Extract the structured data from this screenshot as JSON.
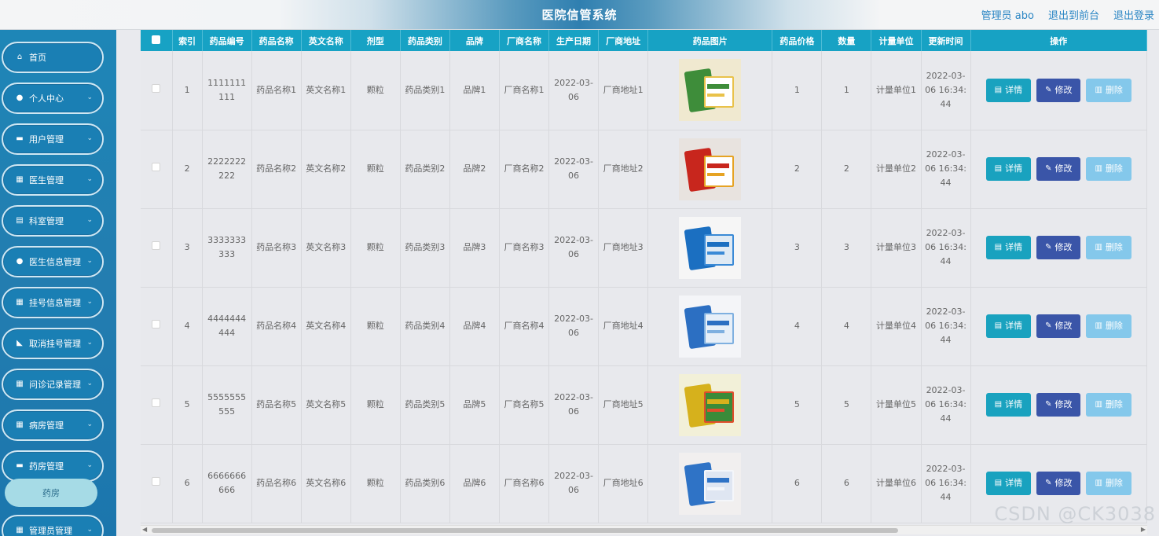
{
  "header": {
    "title": "医院信管系统",
    "links": [
      "管理员 abo",
      "退出到前台",
      "退出登录"
    ]
  },
  "sidebar": {
    "items": [
      {
        "label": "首页",
        "icon": "home-icon",
        "glyph": "⌂",
        "chevron": false
      },
      {
        "label": "个人中心",
        "icon": "user-icon",
        "glyph": "●",
        "chevron": true
      },
      {
        "label": "用户管理",
        "icon": "briefcase-icon",
        "glyph": "▬",
        "chevron": true
      },
      {
        "label": "医生管理",
        "icon": "grid-icon",
        "glyph": "▦",
        "chevron": true
      },
      {
        "label": "科室管理",
        "icon": "document-icon",
        "glyph": "▤",
        "chevron": true
      },
      {
        "label": "医生信息管理",
        "icon": "user-icon",
        "glyph": "●",
        "chevron": true
      },
      {
        "label": "挂号信息管理",
        "icon": "grid-icon",
        "glyph": "▦",
        "chevron": true
      },
      {
        "label": "取消挂号管理",
        "icon": "thumb-icon",
        "glyph": "◣",
        "chevron": true
      },
      {
        "label": "问诊记录管理",
        "icon": "grid-icon",
        "glyph": "▦",
        "chevron": true
      },
      {
        "label": "病房管理",
        "icon": "grid-icon",
        "glyph": "▦",
        "chevron": true
      },
      {
        "label": "药房管理",
        "icon": "car-icon",
        "glyph": "▬",
        "chevron": true
      },
      {
        "label": "管理员管理",
        "icon": "grid-icon",
        "glyph": "▦",
        "chevron": true
      }
    ],
    "submenu": {
      "label": "药房"
    }
  },
  "table": {
    "columns": [
      "",
      "索引",
      "药品编号",
      "药品名称",
      "英文名称",
      "剂型",
      "药品类别",
      "品牌",
      "厂商名称",
      "生产日期",
      "厂商地址",
      "药品图片",
      "药品价格",
      "数量",
      "计量单位",
      "更新时间",
      "操作"
    ],
    "rows": [
      {
        "index": "1",
        "code": "1111111111",
        "name": "药品名称1",
        "en": "英文名称1",
        "form": "颗粒",
        "category": "药品类别1",
        "brand": "品牌1",
        "maker": "厂商名称1",
        "date": "2022-03-06",
        "address": "厂商地址1",
        "image": "medicine-photo-1",
        "price": "1",
        "qty": "1",
        "unit": "计量单位1",
        "updated": "2022-03-06 16:34:44"
      },
      {
        "index": "2",
        "code": "2222222222",
        "name": "药品名称2",
        "en": "英文名称2",
        "form": "颗粒",
        "category": "药品类别2",
        "brand": "品牌2",
        "maker": "厂商名称2",
        "date": "2022-03-06",
        "address": "厂商地址2",
        "image": "medicine-photo-2",
        "price": "2",
        "qty": "2",
        "unit": "计量单位2",
        "updated": "2022-03-06 16:34:44"
      },
      {
        "index": "3",
        "code": "3333333333",
        "name": "药品名称3",
        "en": "英文名称3",
        "form": "颗粒",
        "category": "药品类别3",
        "brand": "品牌3",
        "maker": "厂商名称3",
        "date": "2022-03-06",
        "address": "厂商地址3",
        "image": "medicine-photo-3",
        "price": "3",
        "qty": "3",
        "unit": "计量单位3",
        "updated": "2022-03-06 16:34:44"
      },
      {
        "index": "4",
        "code": "4444444444",
        "name": "药品名称4",
        "en": "英文名称4",
        "form": "颗粒",
        "category": "药品类别4",
        "brand": "品牌4",
        "maker": "厂商名称4",
        "date": "2022-03-06",
        "address": "厂商地址4",
        "image": "medicine-photo-4",
        "price": "4",
        "qty": "4",
        "unit": "计量单位4",
        "updated": "2022-03-06 16:34:44"
      },
      {
        "index": "5",
        "code": "5555555555",
        "name": "药品名称5",
        "en": "英文名称5",
        "form": "颗粒",
        "category": "药品类别5",
        "brand": "品牌5",
        "maker": "厂商名称5",
        "date": "2022-03-06",
        "address": "厂商地址5",
        "image": "medicine-photo-5",
        "price": "5",
        "qty": "5",
        "unit": "计量单位5",
        "updated": "2022-03-06 16:34:44"
      },
      {
        "index": "6",
        "code": "6666666666",
        "name": "药品名称6",
        "en": "英文名称6",
        "form": "颗粒",
        "category": "药品类别6",
        "brand": "品牌6",
        "maker": "厂商名称6",
        "date": "2022-03-06",
        "address": "厂商地址6",
        "image": "medicine-photo-6",
        "price": "6",
        "qty": "6",
        "unit": "计量单位6",
        "updated": "2022-03-06 16:34:44"
      }
    ],
    "actions": {
      "detail": "详情",
      "edit": "修改",
      "delete": "删除"
    }
  },
  "watermark": "CSDN @CK3038",
  "colors": {
    "header_accent": "#2f7fb0",
    "sidebar": "#1e86b7",
    "table_header": "#17a2c4",
    "btn_detail": "#19a2bf",
    "btn_edit": "#3a55a8",
    "btn_delete": "#84c8eb"
  }
}
